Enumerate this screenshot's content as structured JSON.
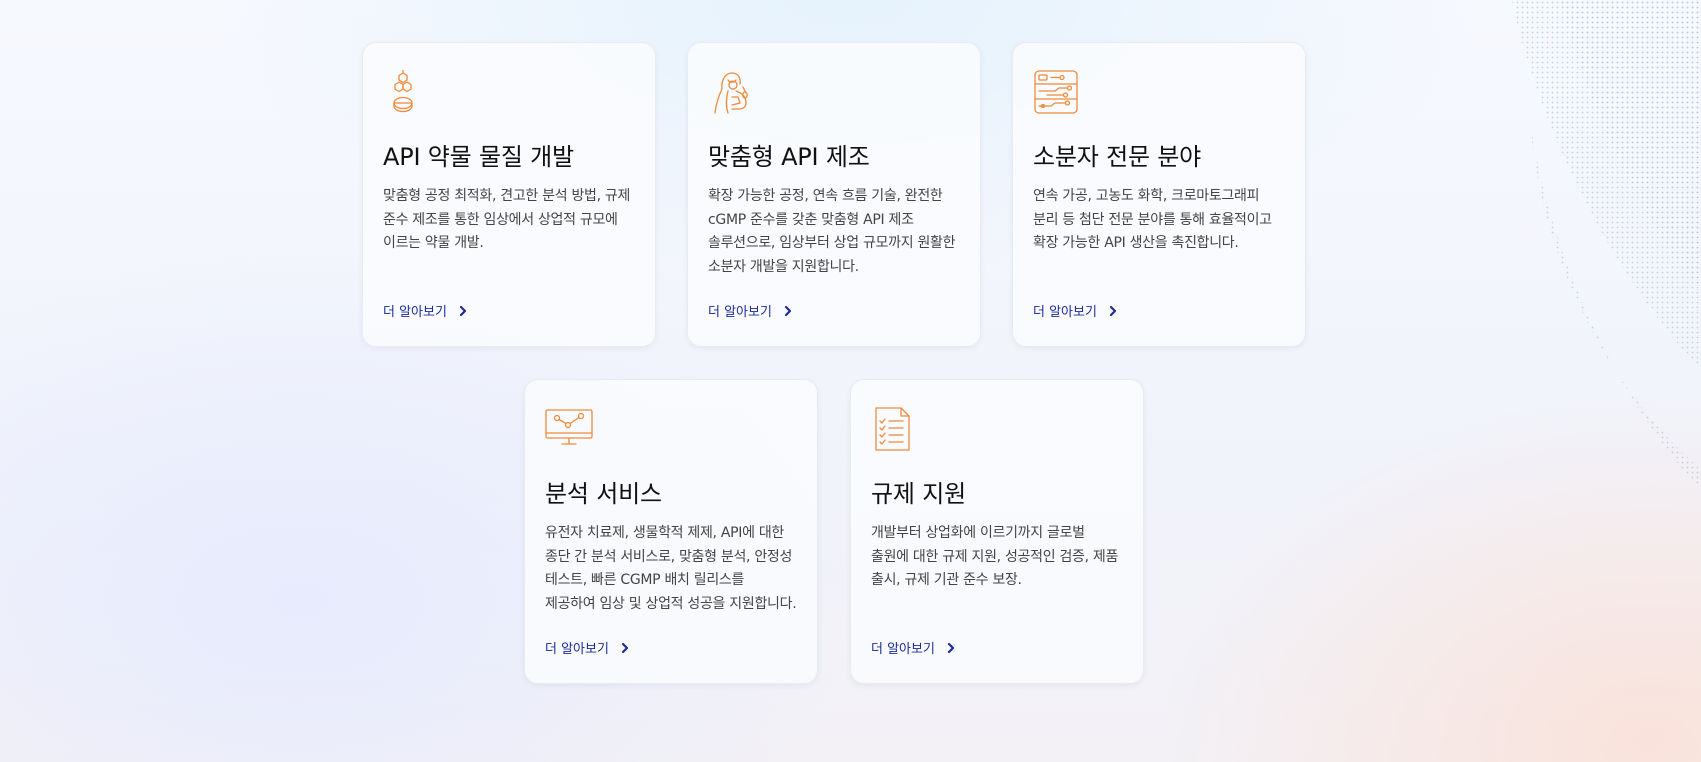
{
  "colors": {
    "icon": "#f08a3c",
    "link": "#1d2a9a",
    "title": "#111111",
    "text": "#444444"
  },
  "cards": [
    {
      "icon": "molecule-pill-icon",
      "title": "API 약물 물질 개발",
      "description": "맞춤형 공정 최적화, 견고한 분석 방법, 규제 준수 제조를 통한 임상에서 상업적 규모에 이르는 약물 개발.",
      "link": "더 알아보기"
    },
    {
      "icon": "scientist-icon",
      "title": "맞춤형 API 제조",
      "description": "확장 가능한 공정, 연속 흐름 기술, 완전한 cGMP 준수를 갖춘 맞춤형 API 제조 솔루션으로, 임상부터 상업 규모까지 원활한 소분자 개발을 지원합니다.",
      "link": "더 알아보기"
    },
    {
      "icon": "circuit-board-icon",
      "title": "소분자 전문 분야",
      "description": "연속 가공, 고농도 화학, 크로마토그래피 분리 등 첨단 전문 분야를 통해 효율적이고 확장 가능한 API 생산을 촉진합니다.",
      "link": "더 알아보기"
    },
    {
      "icon": "monitor-network-icon",
      "title": "분석 서비스",
      "description": "유전자 치료제, 생물학적 제제, API에 대한 종단 간 분석 서비스로, 맞춤형 분석, 안정성 테스트, 빠른 CGMP 배치 릴리스를 제공하여 임상 및 상업적 성공을 지원합니다.",
      "link": "더 알아보기"
    },
    {
      "icon": "checklist-document-icon",
      "title": "규제 지원",
      "description": "개발부터 상업화에 이르기까지 글로벌 출원에 대한 규제 지원, 성공적인 검증, 제품 출시, 규제 기관 준수 보장.",
      "link": "더 알아보기"
    }
  ]
}
